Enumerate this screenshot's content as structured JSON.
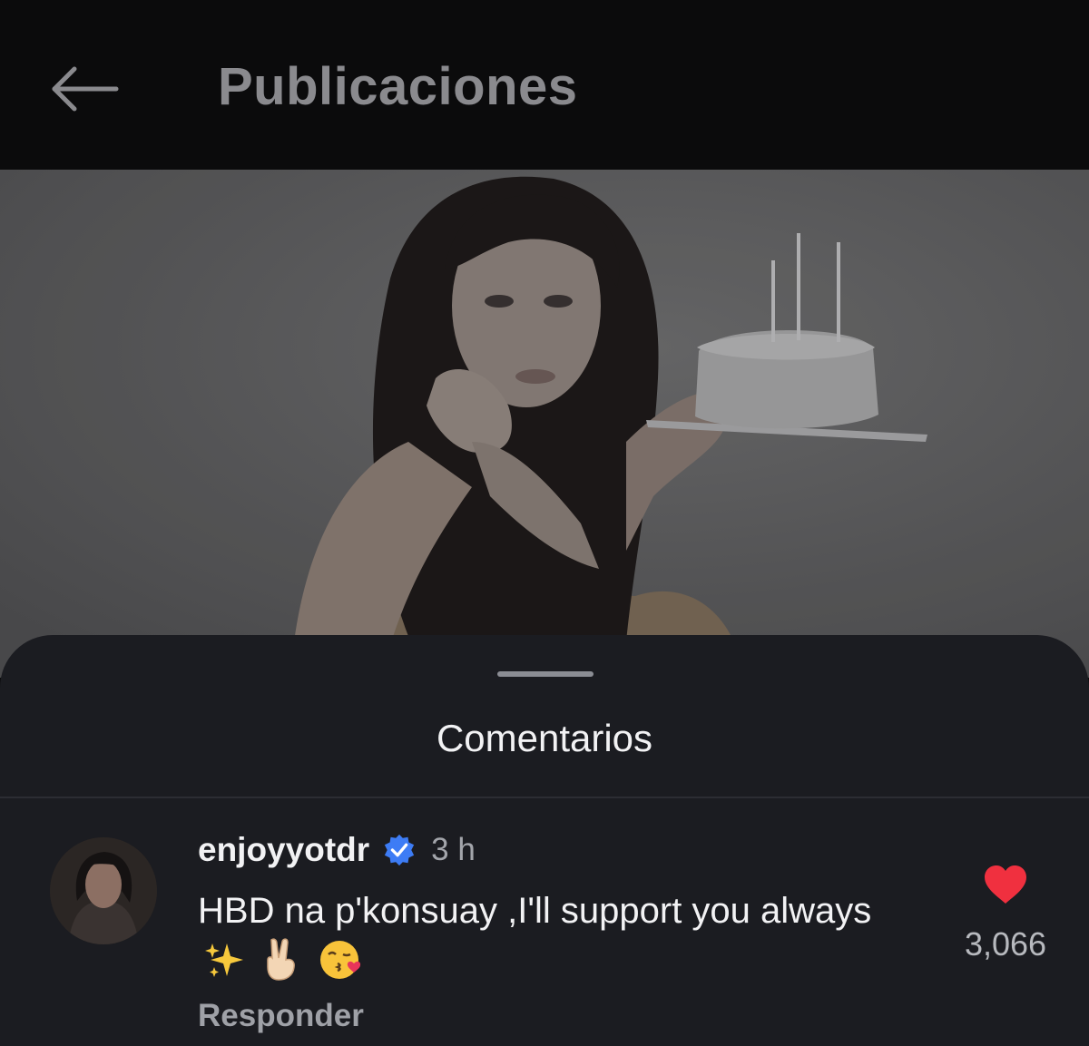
{
  "header": {
    "title": "Publicaciones",
    "back_icon": "arrow-left-icon"
  },
  "post": {
    "image": "photo of a woman with long dark hair holding a white cake with candles"
  },
  "comments_sheet": {
    "title": "Comentarios",
    "comment": {
      "username": "enjoyyotdr",
      "verified": true,
      "time": "3 h",
      "text": "HBD na p'konsuay ,I'll support you always",
      "emojis": [
        "sparkles",
        "victory-hand",
        "kissing-face-with-heart"
      ],
      "reply_label": "Responder",
      "like_count": "3,066",
      "liked": true
    }
  },
  "colors": {
    "like": "#f0303f",
    "verified": "#3d7cf5",
    "sheet_bg": "#1b1c21",
    "header_bg": "#0b0b0c"
  }
}
